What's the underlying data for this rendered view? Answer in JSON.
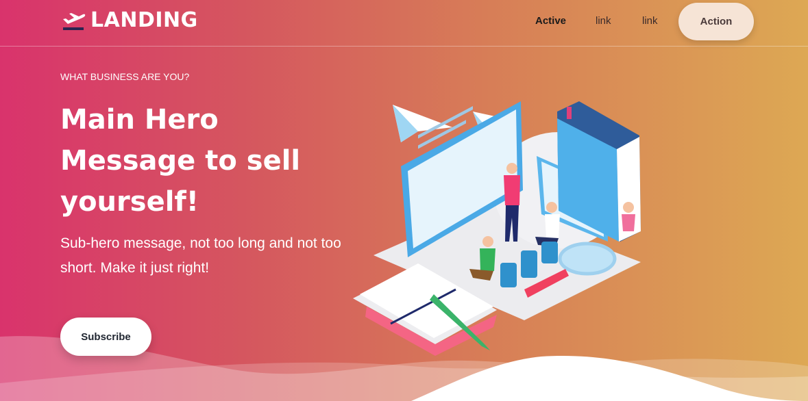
{
  "nav": {
    "logo_text": "LANDING",
    "logo_icon": "airplane-departure-icon",
    "links": [
      {
        "label": "Active",
        "active": true
      },
      {
        "label": "link",
        "active": false
      },
      {
        "label": "link",
        "active": false
      }
    ],
    "action_label": "Action"
  },
  "hero": {
    "eyebrow": "WHAT BUSINESS ARE YOU?",
    "headline": "Main Hero Message to sell yourself!",
    "subhero": "Sub-hero message, not too long and not too short. Make it just right!",
    "cta_label": "Subscribe",
    "illustration": "isometric-office-illustration"
  },
  "colors": {
    "gradient_start": "#d9336c",
    "gradient_end": "#dda854",
    "action_button_bg": "#f6e4d6",
    "cta_bg": "#ffffff"
  }
}
